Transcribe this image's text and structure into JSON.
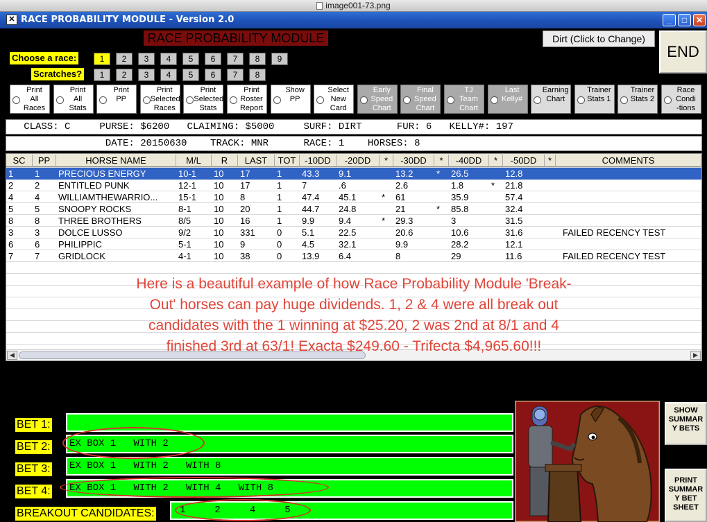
{
  "window": {
    "file_name": "image001-73.png",
    "title": "RACE PROBABILITY MODULE - Version 2.0"
  },
  "header": {
    "module_title": "RACE PROBABILITY MODULE",
    "surface_button": "Dirt (Click to Change)",
    "end_button": "END",
    "choose_label": "Choose  a race:",
    "scratches_label": "Scratches?",
    "races": [
      "1",
      "2",
      "3",
      "4",
      "5",
      "6",
      "7",
      "8",
      "9"
    ],
    "scratches": [
      "1",
      "2",
      "3",
      "4",
      "5",
      "6",
      "7",
      "8"
    ],
    "selected_race": "1"
  },
  "options": [
    {
      "label": "Print\nAll\nRaces",
      "style": "white"
    },
    {
      "label": "Print\nAll\nStats",
      "style": "white"
    },
    {
      "label": "Print\nPP",
      "style": "white"
    },
    {
      "label": "Print\nSelected\nRaces",
      "style": "white"
    },
    {
      "label": "Print\nSelected\nStats",
      "style": "white"
    },
    {
      "label": "Print\nRoster\nReport",
      "style": "white"
    },
    {
      "label": "Show\nPP",
      "style": "white"
    },
    {
      "label": "Select\nNew\nCard",
      "style": "white"
    },
    {
      "label": "Early\nSpeed\nChart",
      "style": "dark"
    },
    {
      "label": "Final\nSpeed\nChart",
      "style": "dark"
    },
    {
      "label": "TJ\nTeam\nChart",
      "style": "dark"
    },
    {
      "label": "Last\nKelly#",
      "style": "dark"
    },
    {
      "label": "Earning\nChart",
      "style": "light"
    },
    {
      "label": "Trainer\nStats 1",
      "style": "light"
    },
    {
      "label": "Trainer\nStats 2",
      "style": "light"
    },
    {
      "label": "Race\nCondi\n-tions",
      "style": "light"
    }
  ],
  "race_info": {
    "line1": "   CLASS: C     PURSE: $6200   CLAIMING: $5000     SURF: DIRT      FUR: 6   KELLY#: 197",
    "line2": "                 DATE: 20150630    TRACK: MNR      RACE: 1    HORSES: 8"
  },
  "table": {
    "columns": [
      "SC",
      "PP",
      "HORSE NAME",
      "M/L",
      "R",
      "LAST",
      "TOT",
      "-10DD",
      "-20DD",
      "*",
      "-30DD",
      "*",
      "-40DD",
      "*",
      "-50DD",
      "*",
      "COMMENTS"
    ],
    "rows": [
      [
        "1",
        "1",
        "PRECIOUS ENERGY",
        "10-1",
        "10",
        "17",
        "1",
        "43.3",
        "9.1",
        "",
        "13.2",
        "*",
        "26.5",
        "",
        "12.8",
        "",
        ""
      ],
      [
        "2",
        "2",
        "ENTITLED PUNK",
        "12-1",
        "10",
        "17",
        "1",
        "7",
        ".6",
        "",
        "2.6",
        "",
        "1.8",
        "*",
        "21.8",
        "",
        ""
      ],
      [
        "4",
        "4",
        "WILLIAMTHEWARRIO...",
        "15-1",
        "10",
        "8",
        "1",
        "47.4",
        "45.1",
        "*",
        "61",
        "",
        "35.9",
        "",
        "57.4",
        "",
        ""
      ],
      [
        "5",
        "5",
        "SNOOPY ROCKS",
        "8-1",
        "10",
        "20",
        "1",
        "44.7",
        "24.8",
        "",
        "21",
        "*",
        "85.8",
        "",
        "32.4",
        "",
        ""
      ],
      [
        "8",
        "8",
        "THREE BROTHERS",
        "8/5",
        "10",
        "16",
        "1",
        "9.9",
        "9.4",
        "*",
        "29.3",
        "",
        "3",
        "",
        "31.5",
        "",
        ""
      ],
      [
        "3",
        "3",
        "DOLCE LUSSO",
        "9/2",
        "10",
        "331",
        "0",
        "5.1",
        "22.5",
        "",
        "20.6",
        "",
        "10.6",
        "",
        "31.6",
        "",
        "FAILED RECENCY TEST"
      ],
      [
        "6",
        "6",
        "PHILIPPIC",
        "5-1",
        "10",
        "9",
        "0",
        "4.5",
        "32.1",
        "",
        "9.9",
        "",
        "28.2",
        "",
        "12.1",
        "",
        ""
      ],
      [
        "7",
        "7",
        "GRIDLOCK",
        "4-1",
        "10",
        "38",
        "0",
        "13.9",
        "6.4",
        "",
        "8",
        "",
        "29",
        "",
        "11.6",
        "",
        "FAILED RECENCY TEST"
      ]
    ],
    "selected_row": 0
  },
  "annotation": {
    "lines": [
      "Here is a beautiful example of how Race Probability Module 'Break-",
      "Out' horses can pay huge dividends.  1, 2 & 4 were all break out",
      "candidates with the 1 winning at $25.20, 2 was 2nd at 8/1 and 4",
      "finished 3rd at 63/1!  Exacta $249.60 - Trifecta $4,965.60!!!"
    ],
    "color": "#e0463a"
  },
  "bets": [
    {
      "label": "BET 1:",
      "value": ""
    },
    {
      "label": "BET 2:",
      "value": "EX BOX 1   WITH 2"
    },
    {
      "label": "BET 3:",
      "value": "EX BOX 1   WITH 2   WITH 8"
    },
    {
      "label": "BET 4:",
      "value": "EX BOX 1   WITH 2   WITH 4   WITH 8"
    }
  ],
  "breakout": {
    "label": "BREAKOUT CANDIDATES:",
    "value": "1     2     4     5"
  },
  "side_buttons": {
    "show": "SHOW\nSUMMAR\nY BETS",
    "print": "PRINT\nSUMMAR\nY BET\nSHEET"
  },
  "colors": {
    "bet_green": "#00ff00",
    "label_yellow": "#ffff00",
    "highlight_oval": "#d9322a",
    "selection_blue": "#3163c5"
  }
}
